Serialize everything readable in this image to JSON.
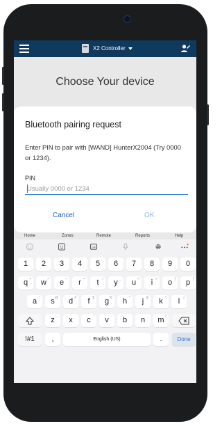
{
  "app_bar": {
    "title": "X2 Controller",
    "menu_icon": "hamburger-menu-icon",
    "device_icon": "controller-device-icon",
    "user_icon": "user-settings-icon"
  },
  "page": {
    "heading": "Choose Your device"
  },
  "dialog": {
    "title": "Bluetooth pairing request",
    "message": "Enter PIN to pair with [WAND] HunterX2004 (Try 0000 or 1234).",
    "pin_label": "PIN",
    "pin_placeholder": "Usually 0000 or 1234",
    "pin_value": "",
    "cancel_label": "Cancel",
    "ok_label": "OK"
  },
  "bottom_tabs": [
    "Home",
    "Zones",
    "Remote",
    "Reports",
    "Help"
  ],
  "keyboard": {
    "toolbar_icons": [
      "emoji-icon",
      "sticker-icon",
      "gif-icon",
      "microphone-icon",
      "settings-icon",
      "more-icon"
    ],
    "row_numbers": [
      "1",
      "2",
      "3",
      "4",
      "5",
      "6",
      "7",
      "8",
      "9",
      "0"
    ],
    "row1": [
      "q",
      "w",
      "e",
      "r",
      "t",
      "y",
      "u",
      "i",
      "o",
      "p"
    ],
    "row1_sub": [
      "+",
      "×",
      "÷",
      "=",
      "/",
      "_",
      "<",
      ">",
      "[",
      "]"
    ],
    "row2": [
      "a",
      "s",
      "d",
      "f",
      "g",
      "h",
      "j",
      "k",
      "l"
    ],
    "row2_sub": [
      "!",
      "@",
      "#",
      "$",
      "%",
      "^",
      "&",
      "*",
      "("
    ],
    "row3": [
      "z",
      "x",
      "c",
      "v",
      "b",
      "n",
      "m"
    ],
    "row3_sub": [
      "-",
      "'",
      "\"",
      ":",
      ";",
      ",",
      "?"
    ],
    "symbols_label": "!#1",
    "comma_label": ",",
    "space_label": "English (US)",
    "period_label": ".",
    "done_label": "Done"
  },
  "colors": {
    "app_bar": "#0f3a5e",
    "link_blue": "#1e5fb4",
    "ok_disabled": "#8fb7e6",
    "input_underline": "#2b7dd6"
  }
}
